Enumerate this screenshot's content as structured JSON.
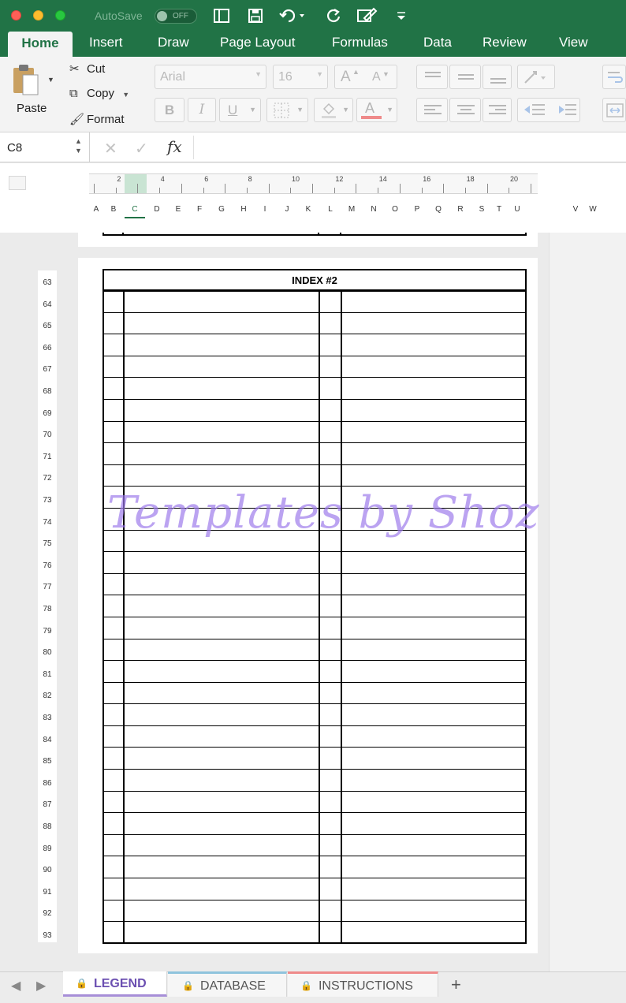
{
  "titlebar": {
    "autosave_label": "AutoSave",
    "autosave_state": "OFF"
  },
  "ribbon_tabs": [
    "Home",
    "Insert",
    "Draw",
    "Page Layout",
    "Formulas",
    "Data",
    "Review",
    "View"
  ],
  "clipboard": {
    "paste": "Paste",
    "cut": "Cut",
    "copy": "Copy",
    "format": "Format"
  },
  "font": {
    "name": "Arial",
    "size": "16",
    "bold": "B",
    "italic": "I",
    "underline": "U",
    "grow": "A",
    "shrink": "A",
    "color": "A"
  },
  "formula_bar": {
    "cell_ref": "C8",
    "fx": "fx",
    "cancel": "✕",
    "enter": "✓",
    "value": ""
  },
  "ruler_numbers": [
    "2",
    "4",
    "6",
    "8",
    "10",
    "12",
    "14",
    "16",
    "18",
    "20"
  ],
  "columns": [
    "A",
    "B",
    "C",
    "D",
    "E",
    "F",
    "G",
    "H",
    "I",
    "J",
    "K",
    "L",
    "M",
    "N",
    "O",
    "P",
    "Q",
    "R",
    "S",
    "T",
    "U"
  ],
  "columns_right": [
    "V",
    "W"
  ],
  "active_column": "C",
  "rows": [
    "63",
    "64",
    "65",
    "66",
    "67",
    "68",
    "69",
    "70",
    "71",
    "72",
    "73",
    "74",
    "75",
    "76",
    "77",
    "78",
    "79",
    "80",
    "81",
    "82",
    "83",
    "84",
    "85",
    "86",
    "87",
    "88",
    "89",
    "90",
    "91",
    "92",
    "93"
  ],
  "index_title": "INDEX #2",
  "watermark": "Templates by Shoz",
  "sheet_tabs": [
    {
      "label": "LEGEND",
      "active": true,
      "accent": "#a78fd8"
    },
    {
      "label": "DATABASE",
      "active": false,
      "accent": "#8fc4dd"
    },
    {
      "label": "INSTRUCTIONS",
      "active": false,
      "accent": "#ef8a8a"
    }
  ],
  "add_sheet": "+",
  "colors": {
    "excel_green": "#217346",
    "watermark": "#9b78eb"
  }
}
